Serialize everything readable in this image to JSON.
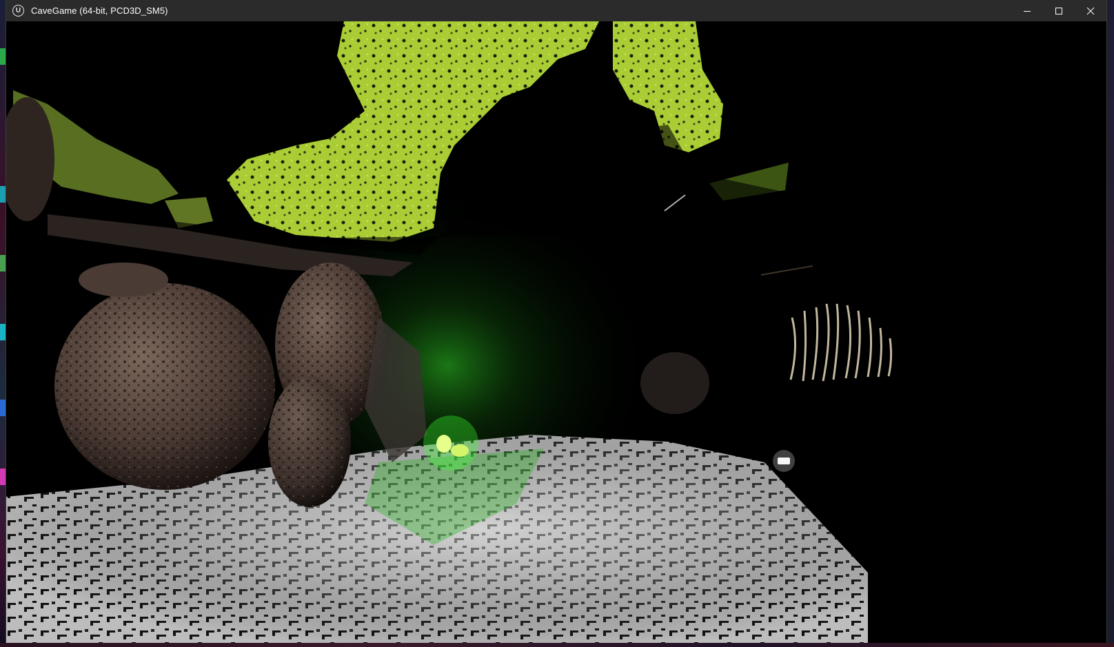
{
  "window": {
    "title": "CaveGame (64-bit, PCD3D_SM5)",
    "app_icon": "unreal-engine-icon",
    "controls": [
      "minimize-icon",
      "maximize-icon",
      "close-icon"
    ]
  },
  "scene": {
    "moss_color": "#b6e03c",
    "glow_color": "#39ff2e",
    "floor_light_color": "#e8e8e8",
    "rock_color": "#5a4a42",
    "roots_color": "#d8ccb0"
  }
}
